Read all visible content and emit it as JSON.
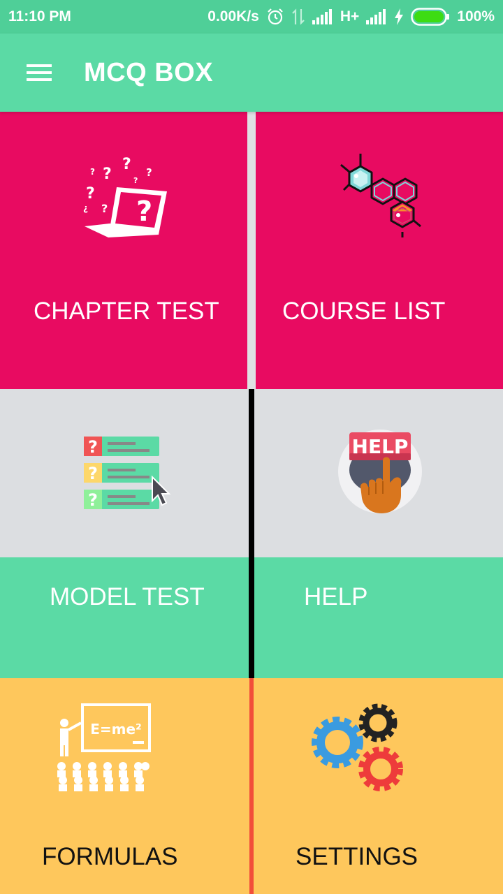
{
  "status_bar": {
    "time": "11:10 PM",
    "speed": "0.00K/s",
    "network": "H+",
    "battery": "100%",
    "icons": [
      "alarm-icon",
      "data-transfer-icon",
      "signal-icon",
      "signal-icon",
      "charging-icon",
      "battery-icon"
    ]
  },
  "app_bar": {
    "menu_icon": "hamburger-menu-icon",
    "title": "MCQ BOX"
  },
  "tiles": [
    {
      "label": "CHAPTER TEST",
      "icon": "laptop-question-icon",
      "color": "#e80b61"
    },
    {
      "label": "COURSE LIST",
      "icon": "molecule-icon",
      "color": "#e80b61"
    },
    {
      "label": "MODEL TEST",
      "icon": "question-list-icon",
      "color": "#5bdaa5"
    },
    {
      "label": "HELP",
      "icon": "help-button-icon",
      "color": "#5bdaa5"
    },
    {
      "label": "FORMULAS",
      "icon": "classroom-formula-icon",
      "color": "#fec75c"
    },
    {
      "label": "SETTINGS",
      "icon": "gears-icon",
      "color": "#fec75c"
    }
  ],
  "formula_board_text": "E=me²",
  "help_sign_text": "HELP"
}
